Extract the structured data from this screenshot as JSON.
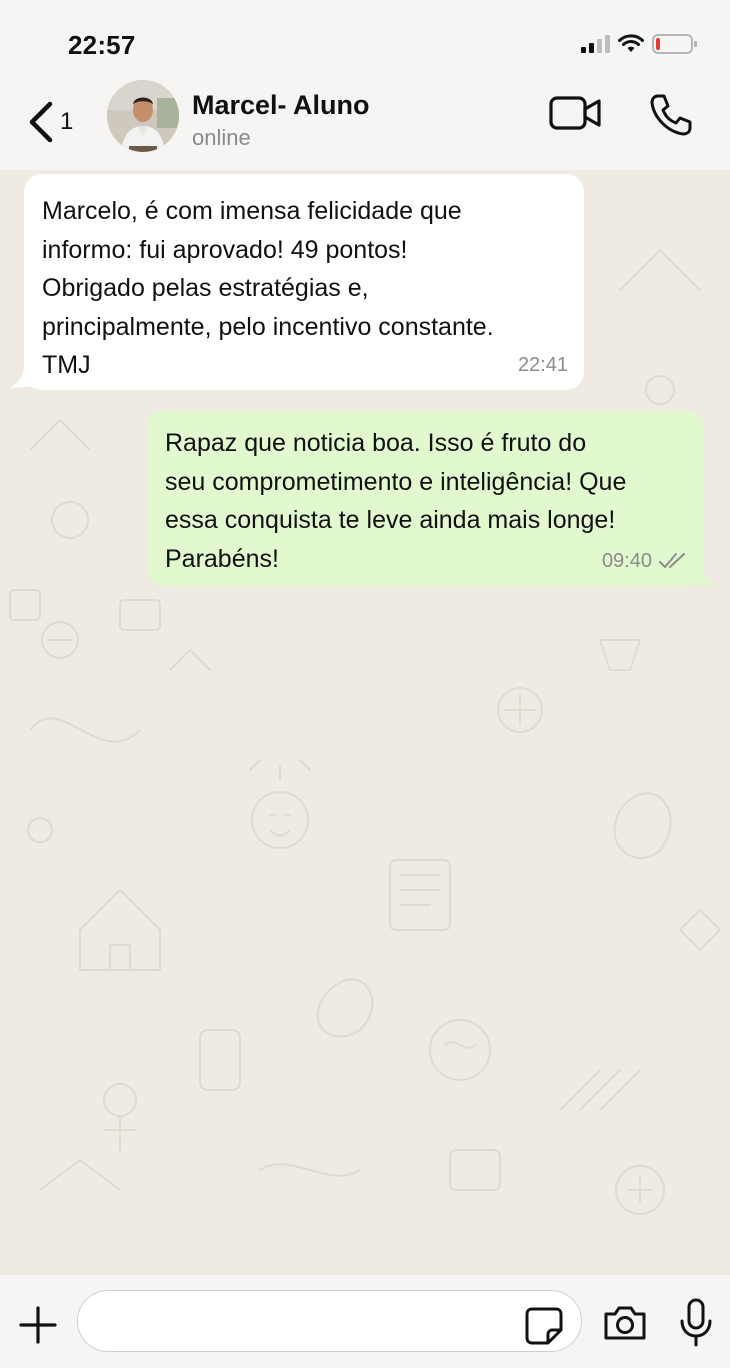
{
  "status_bar": {
    "time": "22:57"
  },
  "header": {
    "back_count": "1",
    "contact_name": "Marcel- Aluno",
    "contact_status": "online"
  },
  "messages": [
    {
      "direction": "incoming",
      "text": "Marcelo, é com imensa felicidade que\ninformo: fui aprovado! 49 pontos!\nObrigado pelas estratégias e,\nprincipalmente, pelo incentivo constante.\nTMJ",
      "time": "22:41"
    },
    {
      "direction": "outgoing",
      "text": "Rapaz que noticia boa. Isso é fruto do\nseu comprometimento e inteligência! Que\nessa conquista te leve ainda mais longe!\nParabéns!",
      "time": "09:40",
      "read": true
    }
  ],
  "input": {
    "placeholder": ""
  },
  "colors": {
    "incoming_bubble": "#ffffff",
    "outgoing_bubble": "#e2f8cf",
    "chat_background": "#efeae2",
    "battery_low": "#e53935",
    "read_ticks": "#8c8c8c"
  }
}
